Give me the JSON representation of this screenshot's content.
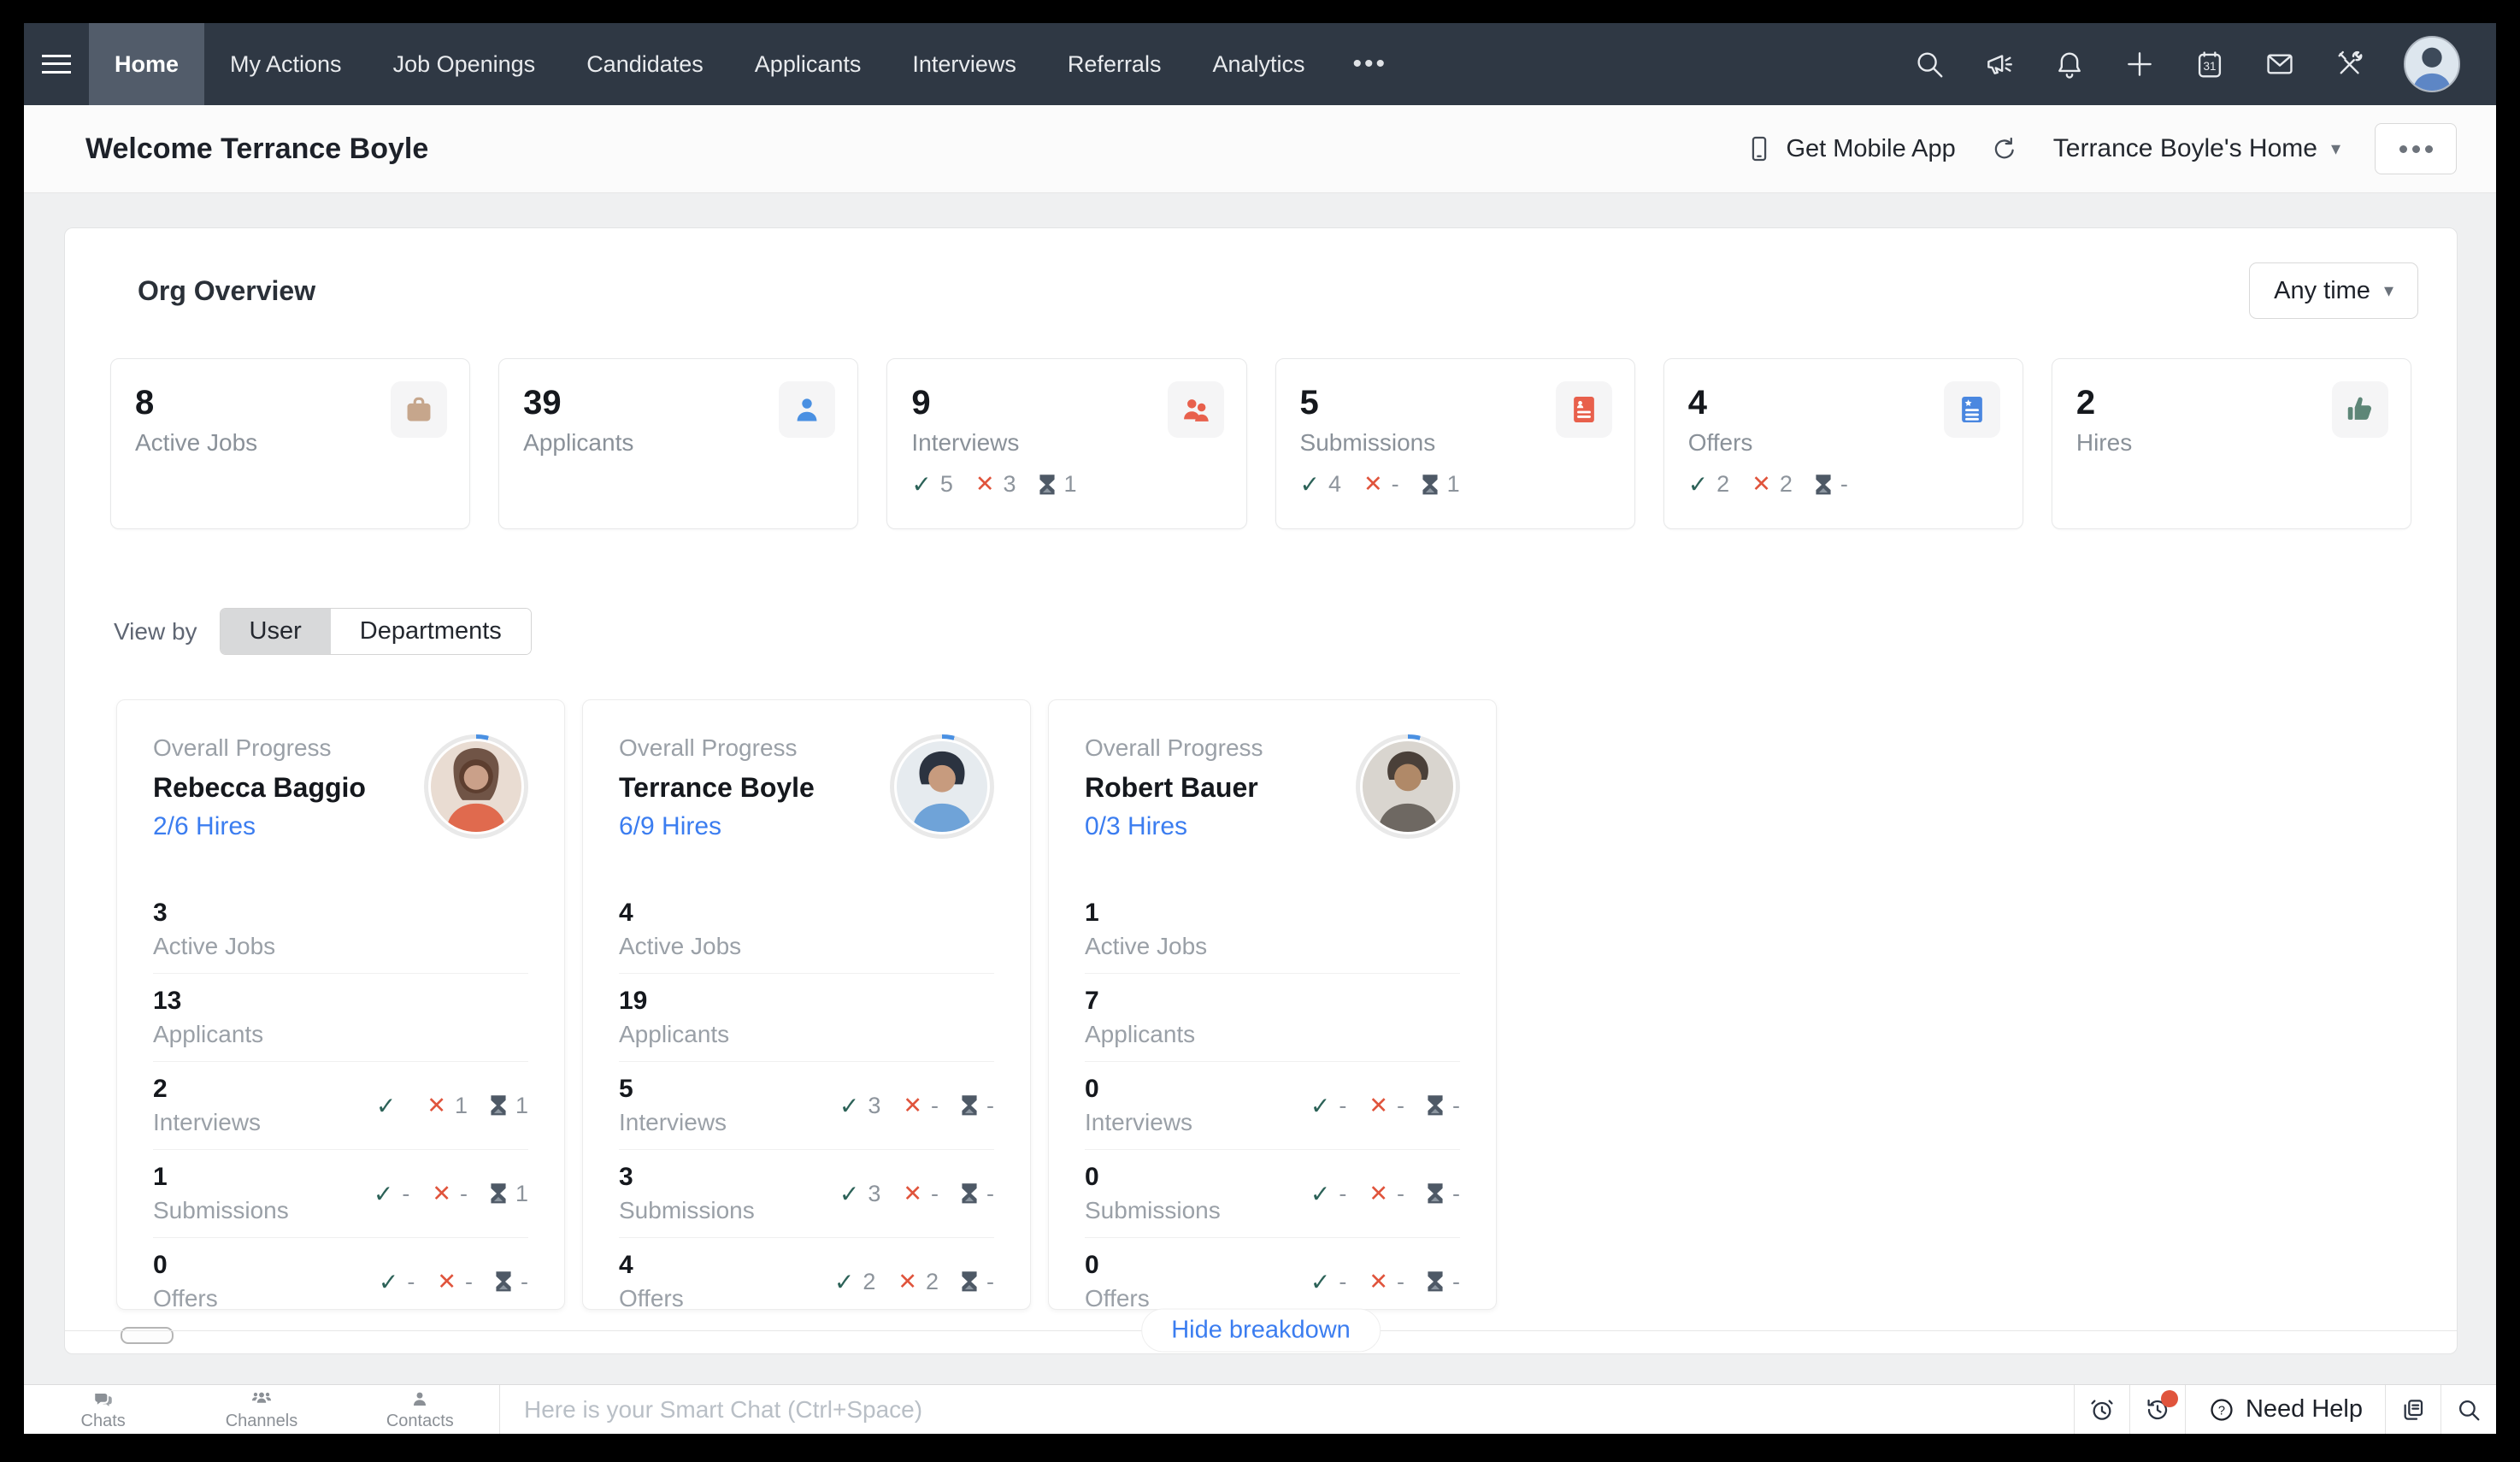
{
  "nav": {
    "active": "Home",
    "items": [
      "Home",
      "My Actions",
      "Job Openings",
      "Candidates",
      "Applicants",
      "Interviews",
      "Referrals",
      "Analytics"
    ],
    "more_label": "•••",
    "icons": [
      "search-icon",
      "megaphone-icon",
      "bell-icon",
      "plus-icon",
      "calendar-icon",
      "mail-icon",
      "tools-icon",
      "avatar"
    ]
  },
  "header": {
    "title": "Welcome Terrance Boyle",
    "get_mobile_app": "Get Mobile App",
    "home_selector": "Terrance Boyle's Home",
    "caret": "▾"
  },
  "org_overview": {
    "title": "Org Overview",
    "time_filter": "Any time",
    "stats": [
      {
        "value": "8",
        "label": "Active Jobs",
        "icon": "briefcase-icon",
        "icon_color": "#c6a68c",
        "breakdown": null
      },
      {
        "value": "39",
        "label": "Applicants",
        "icon": "person-icon",
        "icon_color": "#4a90e2",
        "breakdown": null
      },
      {
        "value": "9",
        "label": "Interviews",
        "icon": "people-icon",
        "icon_color": "#e8604c",
        "breakdown": {
          "check": "5",
          "x": "3",
          "pending": "1"
        }
      },
      {
        "value": "5",
        "label": "Submissions",
        "icon": "doc-person-icon",
        "icon_color": "#e8604c",
        "breakdown": {
          "check": "4",
          "x": "-",
          "pending": "1"
        }
      },
      {
        "value": "4",
        "label": "Offers",
        "icon": "doc-star-icon",
        "icon_color": "#4a87e0",
        "breakdown": {
          "check": "2",
          "x": "2",
          "pending": "-"
        }
      },
      {
        "value": "2",
        "label": "Hires",
        "icon": "thumbs-up-icon",
        "icon_color": "#5d8677",
        "breakdown": null
      }
    ],
    "view_by": {
      "label": "View by",
      "options": [
        "User",
        "Departments"
      ],
      "active": "User"
    },
    "overall_progress_label": "Overall Progress",
    "users": [
      {
        "name": "Rebecca Baggio",
        "hires": "2/6 Hires",
        "rows": [
          {
            "value": "3",
            "label": "Active Jobs"
          },
          {
            "value": "13",
            "label": "Applicants"
          },
          {
            "value": "2",
            "label": "Interviews",
            "breakdown": {
              "check": "",
              "x": "1",
              "pending": "1"
            }
          },
          {
            "value": "1",
            "label": "Submissions",
            "breakdown": {
              "check": "-",
              "x": "-",
              "pending": "1"
            }
          },
          {
            "value": "0",
            "label": "Offers",
            "breakdown": {
              "check": "-",
              "x": "-",
              "pending": "-"
            }
          }
        ]
      },
      {
        "name": "Terrance Boyle",
        "hires": "6/9 Hires",
        "rows": [
          {
            "value": "4",
            "label": "Active Jobs"
          },
          {
            "value": "19",
            "label": "Applicants"
          },
          {
            "value": "5",
            "label": "Interviews",
            "breakdown": {
              "check": "3",
              "x": "-",
              "pending": "-"
            }
          },
          {
            "value": "3",
            "label": "Submissions",
            "breakdown": {
              "check": "3",
              "x": "-",
              "pending": "-"
            }
          },
          {
            "value": "4",
            "label": "Offers",
            "breakdown": {
              "check": "2",
              "x": "2",
              "pending": "-"
            }
          }
        ]
      },
      {
        "name": "Robert Bauer",
        "hires": "0/3 Hires",
        "rows": [
          {
            "value": "1",
            "label": "Active Jobs"
          },
          {
            "value": "7",
            "label": "Applicants"
          },
          {
            "value": "0",
            "label": "Interviews",
            "breakdown": {
              "check": "-",
              "x": "-",
              "pending": "-"
            }
          },
          {
            "value": "0",
            "label": "Submissions",
            "breakdown": {
              "check": "-",
              "x": "-",
              "pending": "-"
            }
          },
          {
            "value": "0",
            "label": "Offers",
            "breakdown": {
              "check": "-",
              "x": "-",
              "pending": "-"
            }
          }
        ]
      }
    ],
    "hide_breakdown": "Hide breakdown"
  },
  "bottom_bar": {
    "tabs": [
      {
        "label": "Chats",
        "icon": "chat-bubbles-icon"
      },
      {
        "label": "Channels",
        "icon": "people-group-icon"
      },
      {
        "label": "Contacts",
        "icon": "contact-person-icon"
      }
    ],
    "smart_chat_placeholder": "Here is your Smart Chat (Ctrl+Space)",
    "need_help": "Need Help"
  }
}
